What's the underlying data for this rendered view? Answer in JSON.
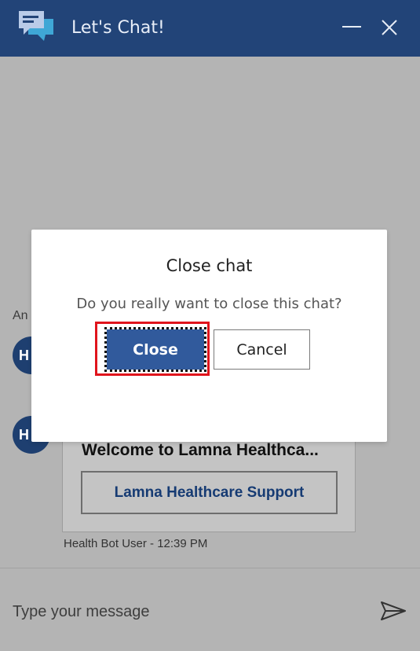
{
  "header": {
    "title": "Let's Chat!",
    "logo_icon": "chat-bubbles-icon",
    "minimize_icon": "minimize-icon",
    "close_icon": "close-icon",
    "bg_color": "#224478"
  },
  "chat": {
    "truncated_text": "An",
    "avatar_initials": "H",
    "card": {
      "title": "Welcome to Lamna Healthca...",
      "button_label": "Lamna Healthcare Support"
    },
    "timestamp": "Health Bot User - 12:39 PM"
  },
  "input": {
    "placeholder": "Type your message",
    "send_icon": "send-icon"
  },
  "dialog": {
    "title": "Close chat",
    "message": "Do you really want to close this chat?",
    "confirm_label": "Close",
    "cancel_label": "Cancel",
    "confirm_color": "#315a9c",
    "highlight_color": "#e0141c"
  }
}
